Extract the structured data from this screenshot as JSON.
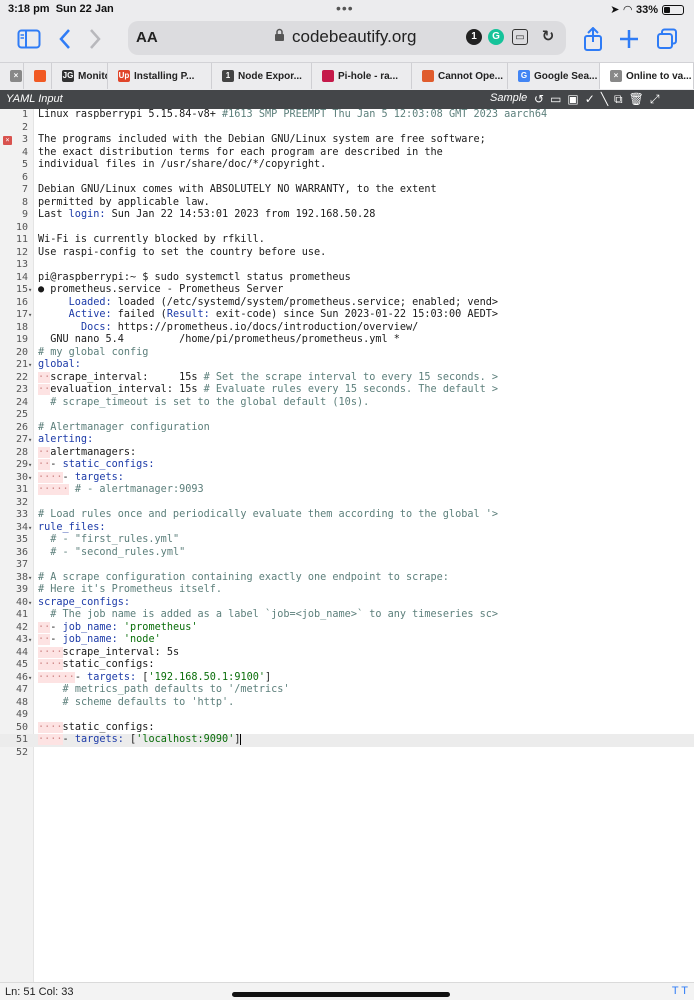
{
  "status_bar": {
    "time": "3:18 pm",
    "date": "Sun 22 Jan",
    "battery": "33%",
    "battery_level": 0.33,
    "indicator": "•••"
  },
  "browser": {
    "aa_label": "AA",
    "url": "codebeautify.org",
    "tabs": [
      {
        "label": "",
        "icon": "x-icon",
        "color": "#888888"
      },
      {
        "label": "",
        "icon": "brave-icon",
        "color": "#f15a24"
      },
      {
        "label": "Monitoring...",
        "icon": "jg-icon",
        "color": "#333333",
        "favtext": "JG"
      },
      {
        "label": "Installing P...",
        "icon": "up-icon",
        "color": "#e0452a",
        "favtext": "Up"
      },
      {
        "label": "Node Expor...",
        "icon": "github-icon",
        "color": "#444444",
        "favtext": "1"
      },
      {
        "label": "Pi-hole - ra...",
        "icon": "raspberry-icon",
        "color": "#c51a4a"
      },
      {
        "label": "Cannot Ope...",
        "icon": "discourse-icon",
        "color": "#e05c2d"
      },
      {
        "label": "Google Sea...",
        "icon": "google-icon",
        "color": "#4285f4",
        "favtext": "G"
      },
      {
        "label": "Online to va...",
        "icon": "close-icon",
        "color": "#888888",
        "active": true
      }
    ]
  },
  "editor": {
    "title": "YAML Input",
    "sample_label": "Sample",
    "status": "Ln: 51 Col: 33",
    "status_right": "T T",
    "lines": [
      {
        "n": "1",
        "segs": [
          [
            "t",
            "Linux raspberrypi 5.15.84-v8+ "
          ],
          [
            "com",
            "#1613 SMP PREEMPT Thu Jan 5 12:03:08 GMT 2023 aarch64"
          ]
        ]
      },
      {
        "n": "2",
        "segs": []
      },
      {
        "n": "3",
        "err": true,
        "segs": [
          [
            "t",
            "The programs included with the Debian GNU/Linux system are free software;"
          ]
        ]
      },
      {
        "n": "4",
        "segs": [
          [
            "t",
            "the exact distribution terms for each program are described in the"
          ]
        ]
      },
      {
        "n": "5",
        "segs": [
          [
            "t",
            "individual files in /usr/share/doc/*/copyright."
          ]
        ]
      },
      {
        "n": "6",
        "segs": []
      },
      {
        "n": "7",
        "segs": [
          [
            "t",
            "Debian GNU/Linux comes with ABSOLUTELY NO WARRANTY, to the extent"
          ]
        ]
      },
      {
        "n": "8",
        "segs": [
          [
            "t",
            "permitted by applicable law."
          ]
        ]
      },
      {
        "n": "9",
        "segs": [
          [
            "t",
            "Last "
          ],
          [
            "key",
            "login:"
          ],
          [
            "t",
            " Sun Jan 22 14:53:01 2023 from 192.168.50.28"
          ]
        ]
      },
      {
        "n": "10",
        "segs": []
      },
      {
        "n": "11",
        "segs": [
          [
            "t",
            "Wi-Fi is currently blocked by rfkill."
          ]
        ]
      },
      {
        "n": "12",
        "segs": [
          [
            "t",
            "Use raspi-config to set the country before use."
          ]
        ]
      },
      {
        "n": "13",
        "segs": []
      },
      {
        "n": "14",
        "segs": [
          [
            "t",
            "pi@raspberrypi:~ $ sudo systemctl status prometheus"
          ]
        ]
      },
      {
        "n": "15",
        "fold": true,
        "segs": [
          [
            "t",
            "● prometheus.service - Prometheus Server"
          ]
        ]
      },
      {
        "n": "16",
        "segs": [
          [
            "t",
            "     "
          ],
          [
            "key",
            "Loaded:"
          ],
          [
            "t",
            " loaded (/etc/systemd/system/prometheus.service; enabled; vend>"
          ]
        ]
      },
      {
        "n": "17",
        "fold": true,
        "segs": [
          [
            "t",
            "     "
          ],
          [
            "key",
            "Active:"
          ],
          [
            "t",
            " failed ("
          ],
          [
            "key",
            "Result:"
          ],
          [
            "t",
            " exit-code) since Sun 2023-01-22 15:03:00 AEDT>"
          ]
        ]
      },
      {
        "n": "18",
        "segs": [
          [
            "t",
            "       "
          ],
          [
            "key",
            "Docs:"
          ],
          [
            "t",
            " https://prometheus.io/docs/introduction/overview/"
          ]
        ]
      },
      {
        "n": "19",
        "segs": [
          [
            "t",
            "  GNU nano 5.4         /home/pi/prometheus/prometheus.yml *"
          ]
        ]
      },
      {
        "n": "20",
        "segs": [
          [
            "com",
            "# my global config"
          ]
        ]
      },
      {
        "n": "21",
        "fold": true,
        "segs": [
          [
            "key",
            "global:"
          ]
        ]
      },
      {
        "n": "22",
        "segs": [
          [
            "ind",
            "··"
          ],
          [
            "t",
            "scrape_interval:     15s "
          ],
          [
            "com",
            "# Set the scrape interval to every 15 seconds. >"
          ]
        ]
      },
      {
        "n": "23",
        "segs": [
          [
            "ind",
            "··"
          ],
          [
            "t",
            "evaluation_interval: 15s "
          ],
          [
            "com",
            "# Evaluate rules every 15 seconds. The default >"
          ]
        ]
      },
      {
        "n": "24",
        "segs": [
          [
            "t",
            "  "
          ],
          [
            "com",
            "# scrape_timeout is set to the global default (10s)."
          ]
        ]
      },
      {
        "n": "25",
        "segs": []
      },
      {
        "n": "26",
        "segs": [
          [
            "com",
            "# Alertmanager configuration"
          ]
        ]
      },
      {
        "n": "27",
        "fold": true,
        "segs": [
          [
            "key",
            "alerting:"
          ]
        ]
      },
      {
        "n": "28",
        "segs": [
          [
            "ind",
            "··"
          ],
          [
            "t",
            "alertmanagers:"
          ]
        ]
      },
      {
        "n": "29",
        "fold": true,
        "segs": [
          [
            "ind",
            "··"
          ],
          [
            "t",
            "- "
          ],
          [
            "key",
            "static_configs:"
          ]
        ]
      },
      {
        "n": "30",
        "fold": true,
        "segs": [
          [
            "ind",
            "····"
          ],
          [
            "t",
            "- "
          ],
          [
            "key",
            "targets:"
          ]
        ]
      },
      {
        "n": "31",
        "segs": [
          [
            "ind",
            "·····"
          ],
          [
            "t",
            " "
          ],
          [
            "com",
            "# - alertmanager:9093"
          ]
        ]
      },
      {
        "n": "32",
        "segs": []
      },
      {
        "n": "33",
        "segs": [
          [
            "com",
            "# Load rules once and periodically evaluate them according to the global '>"
          ]
        ]
      },
      {
        "n": "34",
        "fold": true,
        "segs": [
          [
            "key",
            "rule_files:"
          ]
        ]
      },
      {
        "n": "35",
        "segs": [
          [
            "t",
            "  "
          ],
          [
            "com",
            "# - \"first_rules.yml\""
          ]
        ]
      },
      {
        "n": "36",
        "segs": [
          [
            "t",
            "  "
          ],
          [
            "com",
            "# - \"second_rules.yml\""
          ]
        ]
      },
      {
        "n": "37",
        "segs": []
      },
      {
        "n": "38",
        "fold": true,
        "segs": [
          [
            "com",
            "# A scrape configuration containing exactly one endpoint to scrape:"
          ]
        ]
      },
      {
        "n": "39",
        "segs": [
          [
            "com",
            "# Here it's Prometheus itself."
          ]
        ]
      },
      {
        "n": "40",
        "fold": true,
        "segs": [
          [
            "key",
            "scrape_configs:"
          ]
        ]
      },
      {
        "n": "41",
        "segs": [
          [
            "t",
            "  "
          ],
          [
            "com",
            "# The job name is added as a label `job=<job_name>` to any timeseries sc>"
          ]
        ]
      },
      {
        "n": "42",
        "segs": [
          [
            "ind",
            "··"
          ],
          [
            "t",
            "- "
          ],
          [
            "key",
            "job_name:"
          ],
          [
            "t",
            " "
          ],
          [
            "str",
            "'prometheus'"
          ]
        ]
      },
      {
        "n": "43",
        "fold": true,
        "segs": [
          [
            "ind",
            "··"
          ],
          [
            "t",
            "- "
          ],
          [
            "key",
            "job_name:"
          ],
          [
            "t",
            " "
          ],
          [
            "str",
            "'node'"
          ]
        ]
      },
      {
        "n": "44",
        "segs": [
          [
            "ind",
            "····"
          ],
          [
            "t",
            "scrape_interval: 5s"
          ]
        ]
      },
      {
        "n": "45",
        "segs": [
          [
            "ind",
            "····"
          ],
          [
            "t",
            "static_configs:"
          ]
        ]
      },
      {
        "n": "46",
        "fold": true,
        "segs": [
          [
            "ind",
            "······"
          ],
          [
            "t",
            "- "
          ],
          [
            "key",
            "targets:"
          ],
          [
            "t",
            " ["
          ],
          [
            "str",
            "'192.168.50.1:9100'"
          ],
          [
            "t",
            "]"
          ]
        ]
      },
      {
        "n": "47",
        "segs": [
          [
            "t",
            "    "
          ],
          [
            "com",
            "# metrics_path defaults to '/metrics'"
          ]
        ]
      },
      {
        "n": "48",
        "segs": [
          [
            "t",
            "    "
          ],
          [
            "com",
            "# scheme defaults to 'http'."
          ]
        ]
      },
      {
        "n": "49",
        "segs": []
      },
      {
        "n": "50",
        "segs": [
          [
            "ind",
            "····"
          ],
          [
            "t",
            "static_configs:"
          ]
        ]
      },
      {
        "n": "51",
        "current": true,
        "segs": [
          [
            "ind",
            "····"
          ],
          [
            "t",
            "- "
          ],
          [
            "key",
            "targets:"
          ],
          [
            "t",
            " ["
          ],
          [
            "str",
            "'localhost:9090'"
          ],
          [
            "t",
            "]"
          ]
        ]
      },
      {
        "n": "52",
        "segs": []
      }
    ]
  }
}
